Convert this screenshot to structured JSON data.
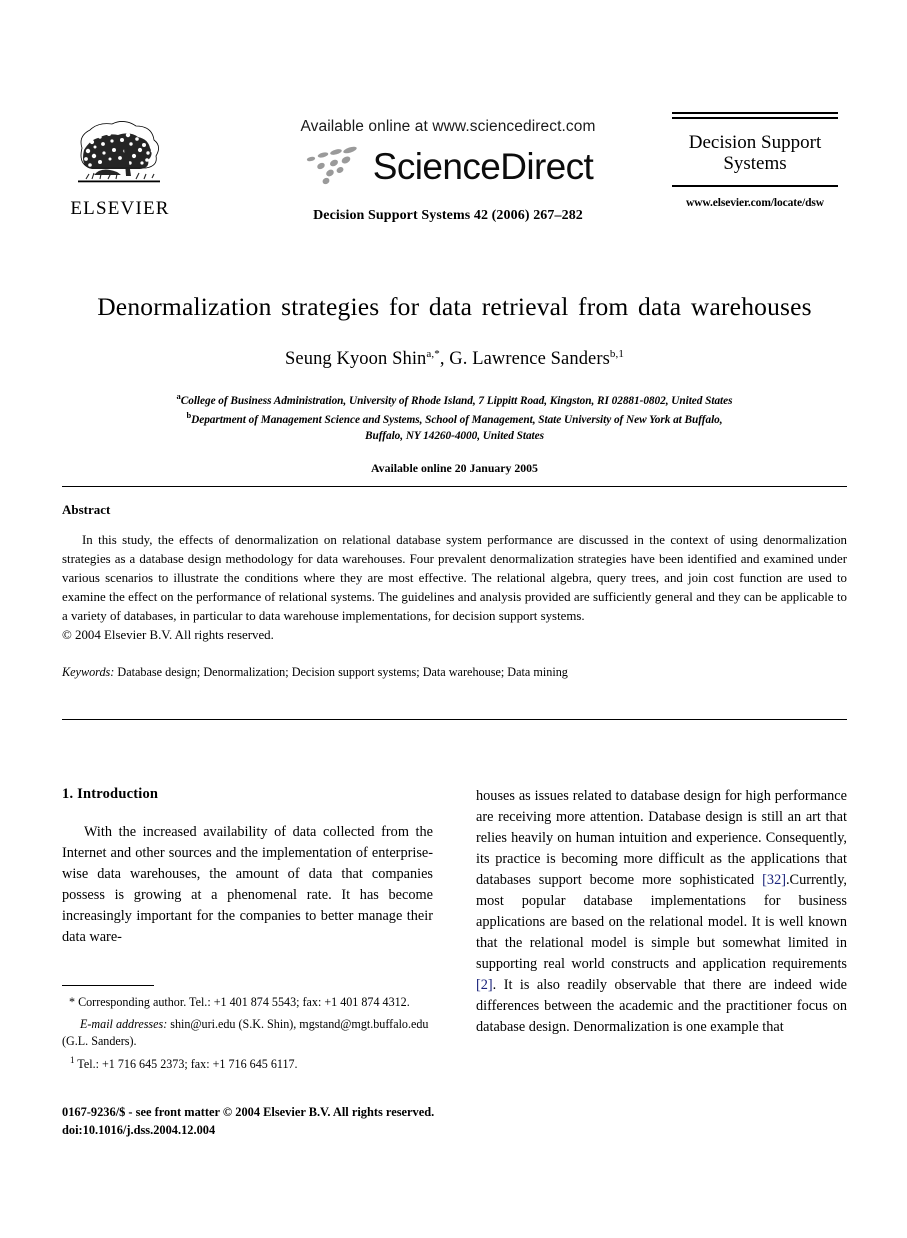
{
  "masthead": {
    "publisher_logo_text": "ELSEVIER",
    "available_online": "Available online at www.sciencedirect.com",
    "brand_wordmark": "ScienceDirect",
    "journal_reference": "Decision Support Systems 42 (2006) 267–282",
    "journal_box": {
      "title_line1": "Decision Support",
      "title_line2": "Systems",
      "url": "www.elsevier.com/locate/dsw"
    }
  },
  "title_block": {
    "title": "Denormalization strategies for data retrieval from data warehouses",
    "authors_html": "Seung Kyoon Shin<sup>a,*</sup>, G. Lawrence Sanders<sup>b,1</sup>",
    "affiliation_a": "College of Business Administration, University of Rhode Island, 7 Lippitt Road, Kingston, RI 02881-0802, United States",
    "affiliation_b_line1": "Department of Management Science and Systems, School of Management, State University of New York at Buffalo,",
    "affiliation_b_line2": "Buffalo, NY 14260-4000, United States",
    "available_online_date": "Available online 20 January 2005"
  },
  "abstract": {
    "heading": "Abstract",
    "body": "In this study, the effects of denormalization on relational database system performance are discussed in the context of using denormalization strategies as a database design methodology for data warehouses. Four prevalent denormalization strategies have been identified and examined under various scenarios to illustrate the conditions where they are most effective. The relational algebra, query trees, and join cost function are used to examine the effect on the performance of relational systems. The guidelines and analysis provided are sufficiently general and they can be applicable to a variety of databases, in particular to data warehouse implementations, for decision support systems.",
    "copyright": "© 2004 Elsevier B.V. All rights reserved.",
    "keywords_label": "Keywords:",
    "keywords_value": " Database design; Denormalization; Decision support systems; Data warehouse; Data mining"
  },
  "body": {
    "section_number_title": "1. Introduction",
    "left_paragraph": "With the increased availability of data collected from the Internet and other sources and the implementation of enterprise-wise data warehouses, the amount of data that companies possess is growing at a phenomenal rate. It has become increasingly important for the companies to better manage their data ware-",
    "right_paragraph_part1": "houses as issues related to database design for high performance are receiving more attention. Database design is still an art that relies heavily on human intuition and experience. Consequently, its practice is becoming more difficult as the applications that databases support become more sophisticated ",
    "right_citation1": "[32]",
    "right_paragraph_part2": ".Currently, most popular database implementations for business applications are based on the relational model. It is well known that the relational model is simple but somewhat limited in supporting real world constructs and application requirements ",
    "right_citation2": "[2]",
    "right_paragraph_part3": ". It is also readily observable that there are indeed wide differences between the academic and the practitioner focus on database design. Denormalization is one example that"
  },
  "footnotes": {
    "corresponding_marker": "*",
    "corresponding_text": " Corresponding author. Tel.: +1 401 874 5543; fax: +1 401 874 4312.",
    "email_label": "E-mail addresses:",
    "email_value": " shin@uri.edu (S.K. Shin), mgstand@mgt.buffalo.edu (G.L. Sanders).",
    "note1_marker": "1",
    "note1_text": " Tel.: +1 716 645 2373; fax: +1 716 645 6117."
  },
  "imprint": {
    "line1": "0167-9236/$ - see front matter © 2004 Elsevier B.V. All rights reserved.",
    "line2": "doi:10.1016/j.dss.2004.12.004"
  },
  "colors": {
    "citation_link": "#19227a",
    "text": "#000000",
    "logo_gray": "#9a9a9a"
  }
}
